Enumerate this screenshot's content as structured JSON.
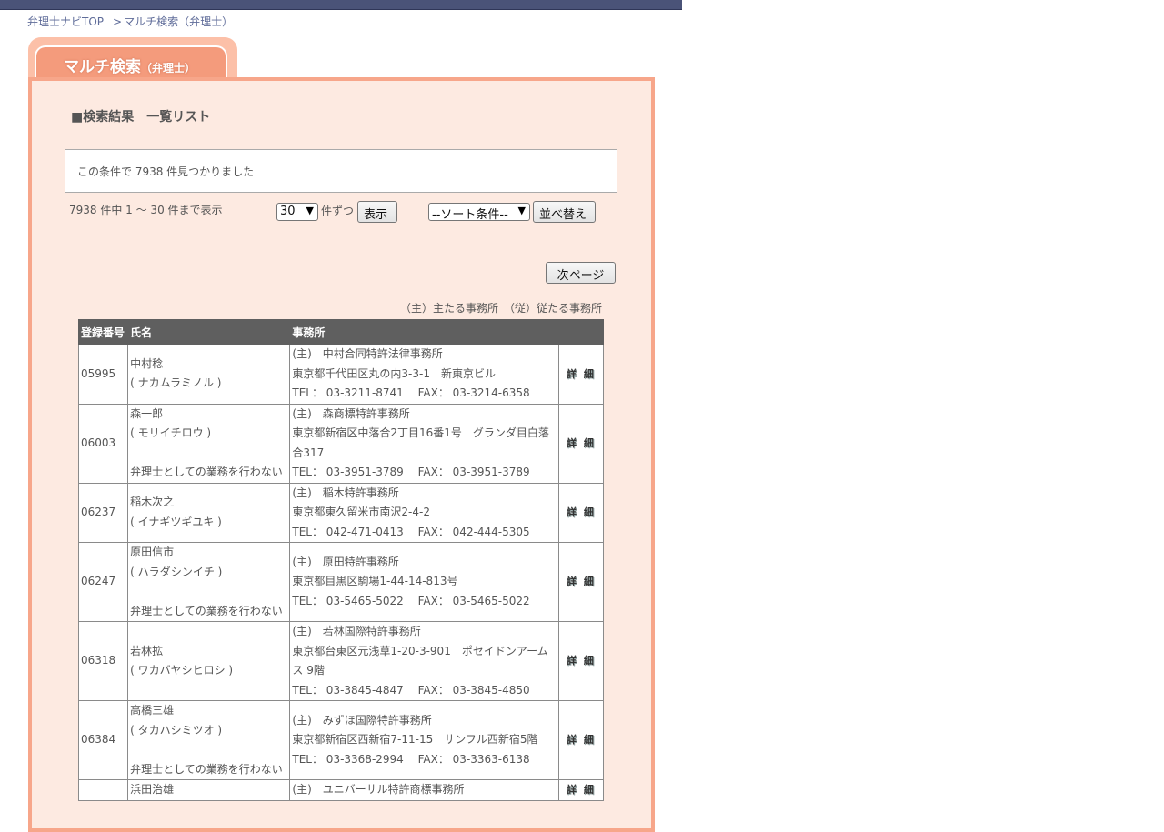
{
  "breadcrumb": {
    "top_link": "弁理士ナビTOP",
    "separator": ">",
    "current": "マルチ検索（弁理士）"
  },
  "tab": {
    "title": "マルチ検索",
    "subtitle": "（弁理士）"
  },
  "section_title": "■検索結果　一覧リスト",
  "result_message": "この条件で 7938 件見つかりました",
  "range_text": "7938 件中 1 〜 30 件まで表示",
  "per_page": {
    "selected": "30",
    "label": "件ずつ",
    "button": "表示"
  },
  "sort": {
    "selected": "--ソート条件--",
    "button": "並べ替え"
  },
  "next_page_button": "次ページ",
  "legend": "（主）主たる事務所　（従）従たる事務所",
  "table": {
    "headers": [
      "登録番号",
      "氏名",
      "事務所",
      ""
    ],
    "detail_label": "詳 細",
    "rows": [
      {
        "reg": "05995",
        "name": "中村稔",
        "kana": "( ナカムラミノル )",
        "note": "",
        "office_name": "(主)　中村合同特許法律事務所",
        "address": "東京都千代田区丸の内3-3-1　新東京ビル",
        "tel": "TEL： 03-3211-8741　 FAX： 03-3214-6358"
      },
      {
        "reg": "06003",
        "name": "森一郎",
        "kana": "( モリイチロウ )",
        "note": "弁理士としての業務を行わない",
        "office_name": "(主)　森商標特許事務所",
        "address": "東京都新宿区中落合2丁目16番1号　グランダ目白落合317",
        "tel": "TEL： 03-3951-3789　 FAX： 03-3951-3789"
      },
      {
        "reg": "06237",
        "name": "稲木次之",
        "kana": "( イナギツギユキ )",
        "note": "",
        "office_name": "(主)　稲木特許事務所",
        "address": "東京都東久留米市南沢2-4-2",
        "tel": "TEL： 042-471-0413　 FAX： 042-444-5305"
      },
      {
        "reg": "06247",
        "name": "原田信市",
        "kana": "( ハラダシンイチ )",
        "note": "弁理士としての業務を行わない",
        "office_name": "(主)　原田特許事務所",
        "address": "東京都目黒区駒場1-44-14-813号",
        "tel": "TEL： 03-5465-5022　 FAX： 03-5465-5022"
      },
      {
        "reg": "06318",
        "name": "若林拡",
        "kana": "( ワカバヤシヒロシ )",
        "note": "",
        "office_name": "(主)　若林国際特許事務所",
        "address": "東京都台東区元浅草1-20-3-901　ポセイドンアームス 9階",
        "tel": "TEL： 03-3845-4847　 FAX： 03-3845-4850"
      },
      {
        "reg": "06384",
        "name": "高橋三雄",
        "kana": "( タカハシミツオ )",
        "note": "弁理士としての業務を行わない",
        "office_name": "(主)　みずほ国際特許事務所",
        "address": "東京都新宿区西新宿7-11-15　サンフル西新宿5階",
        "tel": "TEL： 03-3368-2994　 FAX： 03-3363-6138"
      },
      {
        "reg": "",
        "name": "浜田治雄",
        "kana": "",
        "note": "",
        "office_name": "(主)　ユニバーサル特許商標事務所",
        "address": "",
        "tel": ""
      }
    ]
  }
}
